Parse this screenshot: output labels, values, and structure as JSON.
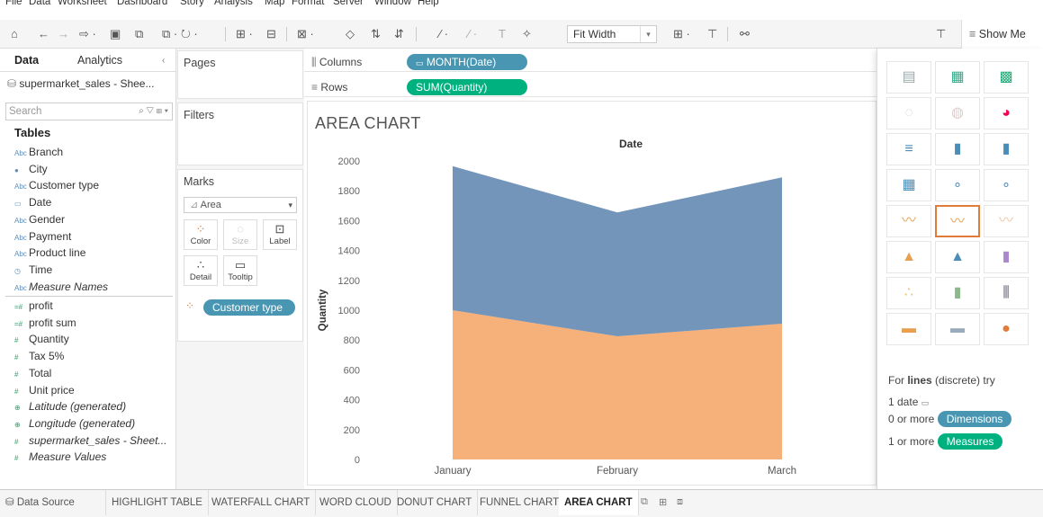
{
  "menubar": [
    "File",
    "Data",
    "Worksheet",
    "Dashboard",
    "Story",
    "Analysis",
    "Map",
    "Format",
    "Server",
    "Window",
    "Help"
  ],
  "toolbar": {
    "fit": "Fit Width",
    "show_me": "Show Me"
  },
  "data_pane": {
    "tabs": [
      "Data",
      "Analytics"
    ],
    "source": "supermarket_sales - Shee...",
    "search_placeholder": "Search",
    "tables_heading": "Tables",
    "dimensions": [
      {
        "icon": "Abc",
        "label": "Branch"
      },
      {
        "icon": "●",
        "label": "City"
      },
      {
        "icon": "Abc",
        "label": "Customer type"
      },
      {
        "icon": "▭",
        "label": "Date"
      },
      {
        "icon": "Abc",
        "label": "Gender"
      },
      {
        "icon": "Abc",
        "label": "Payment"
      },
      {
        "icon": "Abc",
        "label": "Product line"
      },
      {
        "icon": "◷",
        "label": "Time"
      },
      {
        "icon": "Abc",
        "label": "Measure Names"
      }
    ],
    "measures": [
      {
        "icon": "=#",
        "label": "profit"
      },
      {
        "icon": "=#",
        "label": "profit sum"
      },
      {
        "icon": "#",
        "label": "Quantity"
      },
      {
        "icon": "#",
        "label": "Tax 5%"
      },
      {
        "icon": "#",
        "label": "Total"
      },
      {
        "icon": "#",
        "label": "Unit price"
      },
      {
        "icon": "⊕",
        "label": "Latitude (generated)"
      },
      {
        "icon": "⊕",
        "label": "Longitude (generated)"
      },
      {
        "icon": "#",
        "label": "supermarket_sales - Sheet..."
      },
      {
        "icon": "#",
        "label": "Measure Values"
      }
    ]
  },
  "cards": {
    "pages": "Pages",
    "filters": "Filters",
    "marks": "Marks",
    "mark_type": "Area",
    "mark_buttons": [
      "Color",
      "Size",
      "Label",
      "Detail",
      "Tooltip"
    ],
    "color_pill": "Customer type"
  },
  "shelves": {
    "columns_label": "Columns",
    "columns_pill": "MONTH(Date)",
    "rows_label": "Rows",
    "rows_pill": "SUM(Quantity)"
  },
  "view": {
    "title": "AREA CHART"
  },
  "chart_data": {
    "type": "area",
    "stacked": true,
    "title": "AREA CHART",
    "header": "Date",
    "xlabel": "",
    "ylabel": "Quantity",
    "categories": [
      "January",
      "February",
      "March"
    ],
    "ylim": [
      0,
      2000
    ],
    "yticks": [
      0,
      200,
      400,
      600,
      800,
      1000,
      1200,
      1400,
      1600,
      1800,
      2000
    ],
    "series": [
      {
        "values": [
          1000,
          825,
          910
        ],
        "color": "#f4a261"
      },
      {
        "values": [
          965,
          830,
          980
        ],
        "color": "#5b82ad"
      }
    ],
    "grid": false
  },
  "show_me": {
    "hint_prefix": "For",
    "hint_bold": "lines",
    "hint_suffix": "(discrete) try",
    "req1": "1 date",
    "req2_prefix": "0 or more",
    "req2_pill": "Dimensions",
    "req3_prefix": "1 or more",
    "req3_pill": "Measures"
  },
  "bottom_tabs": {
    "data_source": "Data Source",
    "sheets": [
      "HIGHLIGHT TABLE",
      "WATERFALL CHART",
      "WORD CLOUD",
      "DONUT CHART",
      "FUNNEL CHART",
      "AREA CHART"
    ],
    "active": "AREA CHART"
  }
}
